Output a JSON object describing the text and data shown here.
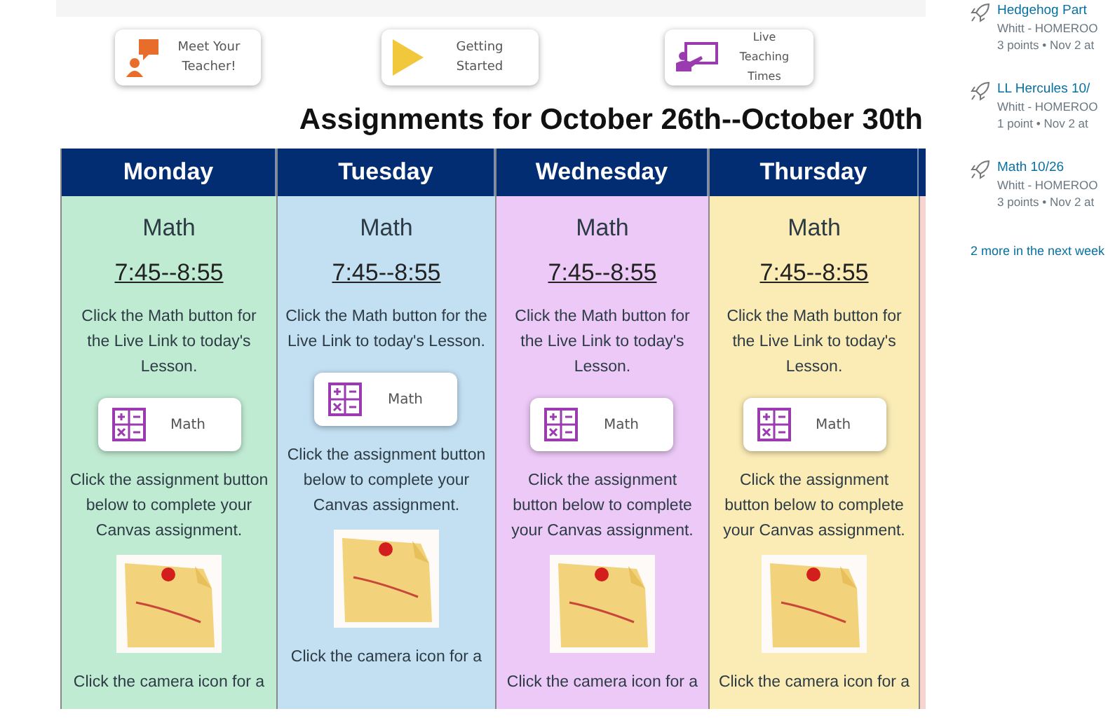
{
  "nav_buttons": [
    {
      "kind": "teacher",
      "label": "Meet Your Teacher!"
    },
    {
      "kind": "play",
      "label": "Getting Started"
    },
    {
      "kind": "board",
      "label": "Live Teaching Times"
    }
  ],
  "heading": "Assignments for October 26th--October 30th",
  "days": [
    {
      "day": "Monday",
      "color": "#c0ebd3",
      "subject": "Math",
      "time": "7:45--8:55",
      "live_text": "Click the Math button for the Live Link to today's Lesson.",
      "button": "Math",
      "assignment_text": "Click the assignment button below to complete your Canvas assignment.",
      "camera_text": "Click the camera icon for a"
    },
    {
      "day": "Tuesday",
      "color": "#c3dff2",
      "subject": "Math",
      "time": "7:45--8:55",
      "live_text": "Click the Math button for the Live Link to today's Lesson.",
      "button": "Math",
      "assignment_text": "Click the assignment button below to complete your Canvas assignment.",
      "camera_text": "Click the camera icon for a"
    },
    {
      "day": "Wednesday",
      "color": "#ecc9f7",
      "subject": "Math",
      "time": "7:45--8:55",
      "live_text": "Click the Math button for the Live Link to today's Lesson.",
      "button": "Math",
      "assignment_text": "Click the assignment button below to complete your Canvas assignment.",
      "camera_text": "Click the camera icon for a"
    },
    {
      "day": "Thursday",
      "color": "#fbebb5",
      "subject": "Math",
      "time": "7:45--8:55",
      "live_text": "Click the Math button for the Live Link to today's Lesson.",
      "button": "Math",
      "assignment_text": "Click the assignment button below to complete your Canvas assignment.",
      "camera_text": "Click the camera icon for a"
    }
  ],
  "todo": {
    "items": [
      {
        "title": "Hedgehog Part",
        "course": "Whitt - HOMEROO",
        "meta": "3 points • Nov 2 at"
      },
      {
        "title": "LL Hercules 10/",
        "course": "Whitt - HOMEROO",
        "meta": "1 point • Nov 2 at"
      },
      {
        "title": "Math 10/26",
        "course": "Whitt - HOMEROO",
        "meta": "3 points • Nov 2 at"
      }
    ],
    "more_link": "2 more in the next week"
  }
}
